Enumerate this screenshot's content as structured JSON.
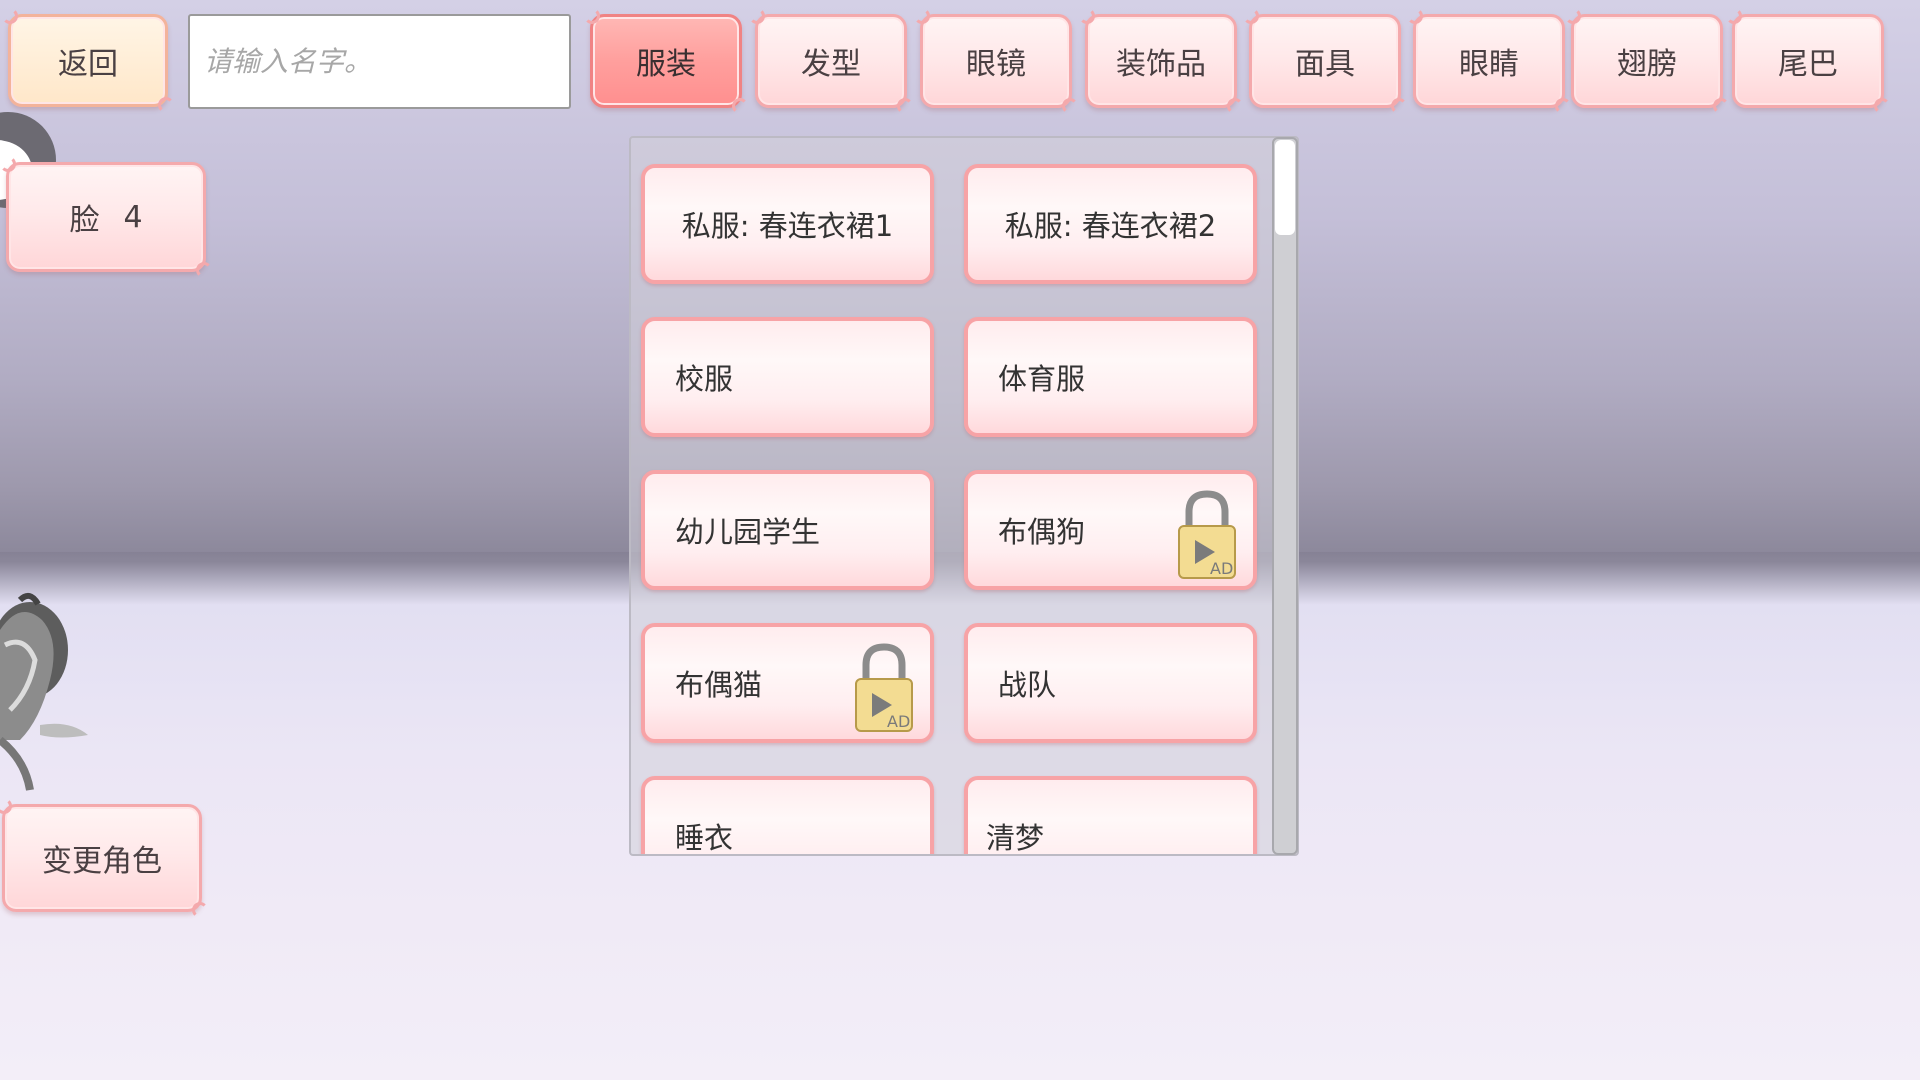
{
  "header": {
    "back_label": "返回",
    "name_placeholder": "请输入名字。",
    "tabs": [
      "服装",
      "发型",
      "眼镜",
      "装饰品",
      "面具",
      "眼睛",
      "翅膀",
      "尾巴"
    ],
    "active_tab": "服装"
  },
  "sidebar": {
    "face_label": "脸",
    "face_value": "4",
    "change_character_label": "变更角色"
  },
  "panel": {
    "items": [
      {
        "label": "私服: 春连衣裙1",
        "locked": false
      },
      {
        "label": "私服: 春连衣裙2",
        "locked": false
      },
      {
        "label": "校服",
        "locked": false
      },
      {
        "label": "体育服",
        "locked": false
      },
      {
        "label": "幼儿园学生",
        "locked": false
      },
      {
        "label": "布偶狗",
        "locked": true
      },
      {
        "label": "布偶猫",
        "locked": true
      },
      {
        "label": "战队",
        "locked": false
      },
      {
        "label": "睡衣",
        "locked": false
      },
      {
        "label": "清梦",
        "locked": false
      }
    ],
    "lock_badge_text": "AD"
  },
  "colors": {
    "accent_pink": "#f4a9ac",
    "active_tab": "#ff9f9d",
    "lock_gold": "#f1d98a"
  }
}
